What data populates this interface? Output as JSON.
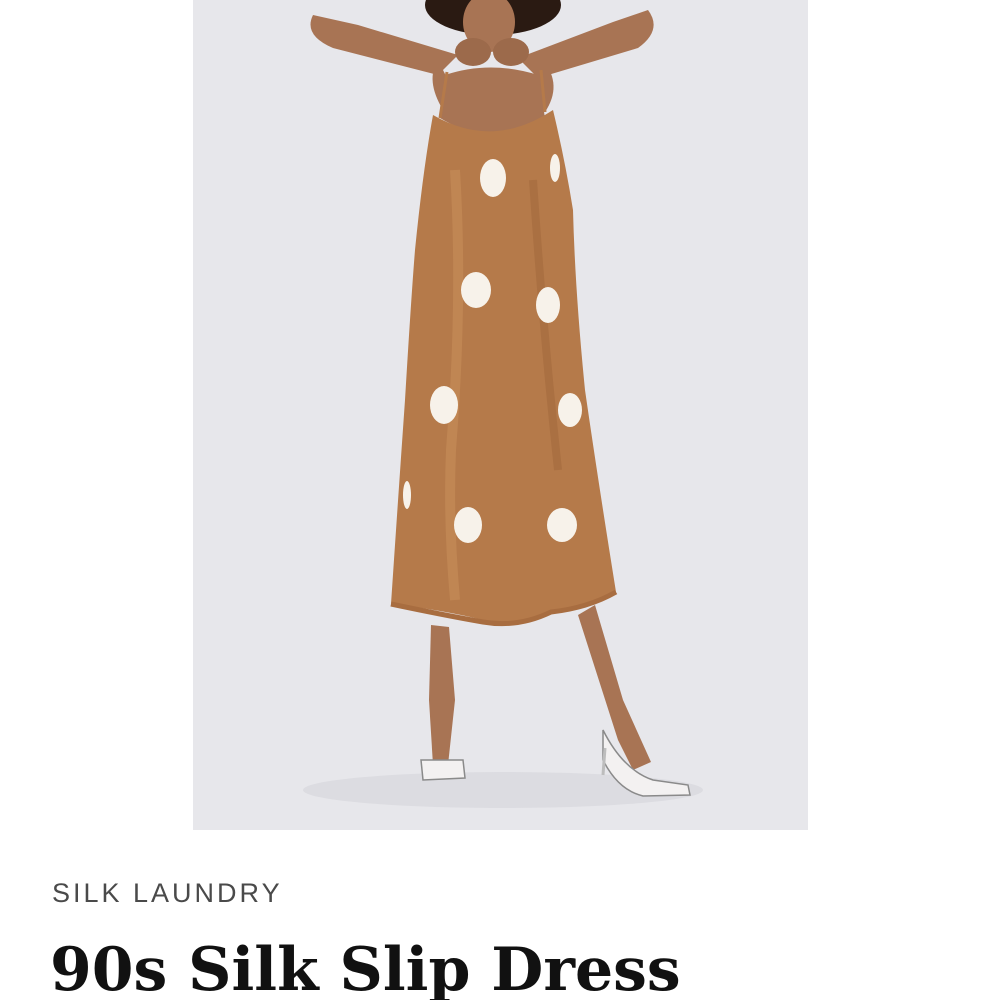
{
  "product": {
    "brand": "SILK LAUNDRY",
    "title": "90s Silk Slip Dress",
    "image_alt": "model wearing caramel polka dot silk slip dress",
    "dress_color": "#b57a4a",
    "dot_color": "#f7f2ea",
    "background_color": "#e7e7eb"
  }
}
